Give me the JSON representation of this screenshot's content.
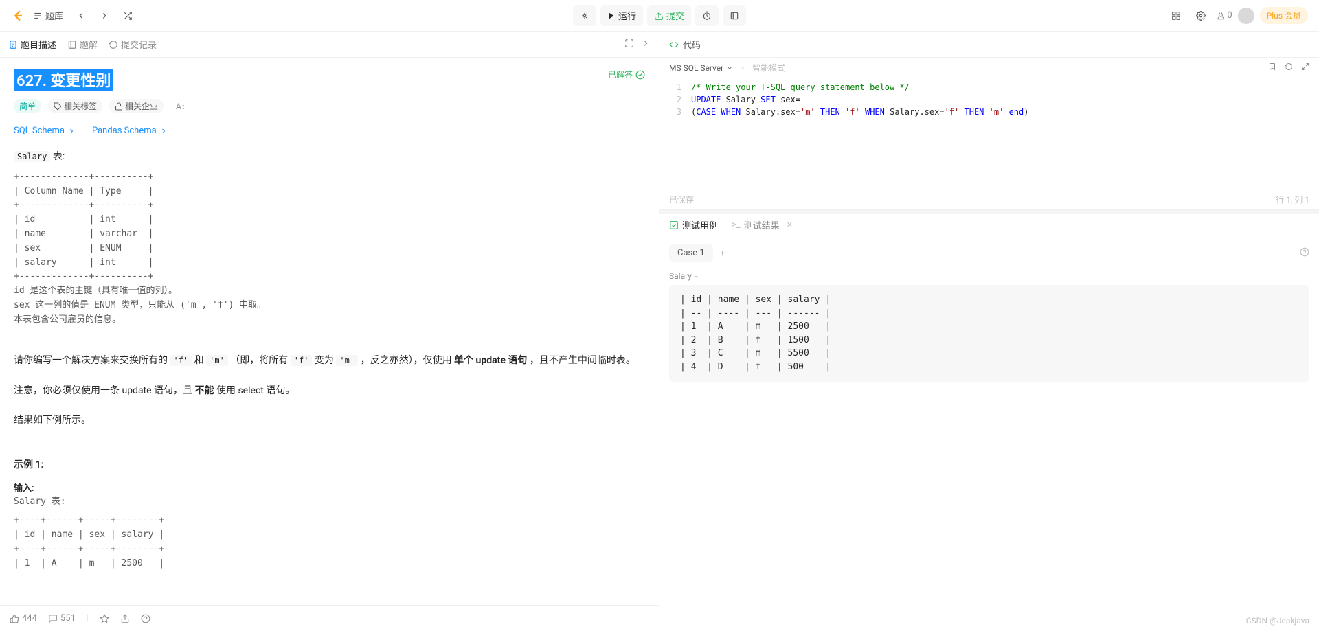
{
  "topbar": {
    "problems_label": "题库",
    "run_label": "运行",
    "submit_label": "提交",
    "fire_count": "0",
    "plus_label": "Plus 会员"
  },
  "left": {
    "tabs": {
      "description": "题目描述",
      "solution": "题解",
      "submissions": "提交记录"
    },
    "solved_label": "已解答",
    "title": "627. 变更性别",
    "difficulty": "简单",
    "tags_label": "相关标签",
    "companies_label": "相关企业",
    "font_label": "A↕",
    "schema_sql": "SQL Schema",
    "schema_pandas": "Pandas Schema",
    "salary_table_label": "Salary",
    "table_suffix": " 表:",
    "table_schema": "+-------------+----------+\n| Column Name | Type     |\n+-------------+----------+\n| id          | int      |\n| name        | varchar  |\n| sex         | ENUM     |\n| salary      | int      |\n+-------------+----------+\nid 是这个表的主键（具有唯一值的列）。\nsex 这一列的值是 ENUM 类型，只能从 ('m', 'f') 中取。\n本表包含公司雇员的信息。",
    "para1_pre": "请你编写一个解决方案来交换所有的 ",
    "para1_and": " 和 ",
    "para1_mid": " （即，将所有 ",
    "para1_to": " 变为 ",
    "para1_end1": " ，反之亦然），仅使用 ",
    "para1_bold": "单个 update 语句",
    "para1_end2": " ，且不产生中间临时表。",
    "para2_pre": "注意，你必须仅使用一条 update 语句，且 ",
    "para2_bold": "不能",
    "para2_end": " 使用 select 语句。",
    "para3": "结果如下例所示。",
    "example_label": "示例 1:",
    "example_input_label": "输入:",
    "example_table_label": "Salary 表:",
    "example_table": "+----+------+-----+--------+\n| id | name | sex | salary |\n+----+------+-----+--------+\n| 1  | A    | m   | 2500   |",
    "footer": {
      "likes": "444",
      "comments": "551"
    }
  },
  "right": {
    "code_label": "代码",
    "language": "MS SQL Server",
    "smart_mode": "智能模式",
    "code": {
      "l1": "/* Write your T-SQL query statement below */",
      "l2_raw": "UPDATE Salary SET sex=",
      "l3_raw": "(CASE WHEN Salary.sex='m' THEN 'f' WHEN Salary.sex='f' THEN 'm' end)"
    },
    "saved_label": "已保存",
    "cursor_label": "行 1, 列 1",
    "result_tabs": {
      "cases": "测试用例",
      "result": "测试结果"
    },
    "case_name": "Case 1",
    "var_label": "Salary =",
    "case_table": "| id | name | sex | salary |\n| -- | ---- | --- | ------ |\n| 1  | A    | m   | 2500   |\n| 2  | B    | f   | 1500   |\n| 3  | C    | m   | 5500   |\n| 4  | D    | f   | 500    |"
  },
  "watermark": "CSDN @Jeakjava"
}
